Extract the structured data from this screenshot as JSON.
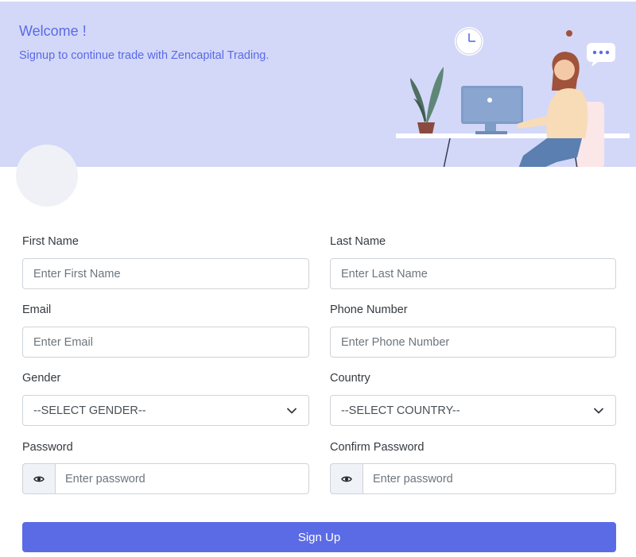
{
  "header": {
    "title": "Welcome !",
    "subtitle": "Signup to continue trade with Zencapital Trading."
  },
  "form": {
    "first_name": {
      "label": "First Name",
      "placeholder": "Enter First Name"
    },
    "last_name": {
      "label": "Last Name",
      "placeholder": "Enter Last Name"
    },
    "email": {
      "label": "Email",
      "placeholder": "Enter Email"
    },
    "phone": {
      "label": "Phone Number",
      "placeholder": "Enter Phone Number"
    },
    "gender": {
      "label": "Gender",
      "selected": "--SELECT GENDER--"
    },
    "country": {
      "label": "Country",
      "selected": "--SELECT COUNTRY--"
    },
    "password": {
      "label": "Password",
      "placeholder": "Enter password",
      "icon": "eye-icon"
    },
    "confirm_password": {
      "label": "Confirm Password",
      "placeholder": "Enter password",
      "icon": "eye-icon"
    },
    "submit_label": "Sign Up"
  },
  "colors": {
    "header_bg": "#d3d8f8",
    "accent": "#5b6be6",
    "avatar_bg": "#eff1f6"
  }
}
